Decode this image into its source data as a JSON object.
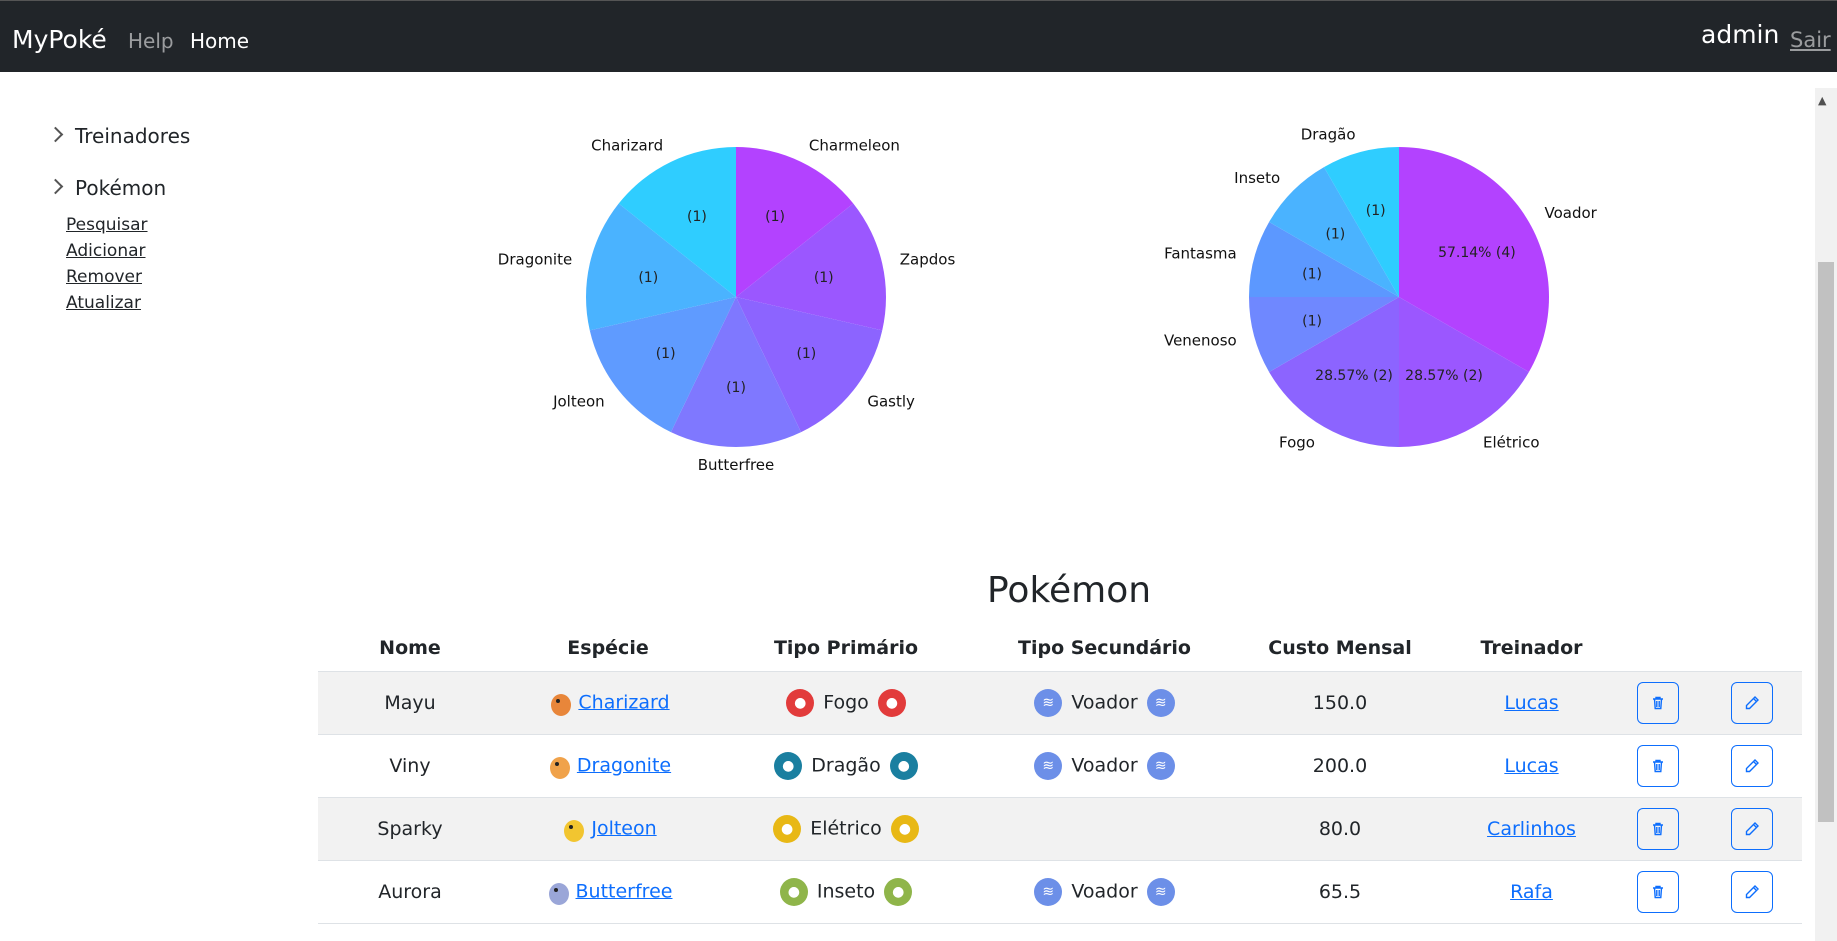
{
  "navbar": {
    "brand": "MyPoké",
    "links": [
      "Help",
      "Home"
    ],
    "user": "admin",
    "logout": "Sair"
  },
  "sidebar": {
    "groups": [
      {
        "label": "Treinadores",
        "expanded": false
      },
      {
        "label": "Pokémon",
        "expanded": true,
        "items": [
          "Pesquisar",
          "Adicionar",
          "Remover",
          "Atualizar"
        ]
      }
    ]
  },
  "chart_data": [
    {
      "type": "pie",
      "title": "",
      "categories": [
        "Charmeleon",
        "Zapdos",
        "Gastly",
        "Butterfree",
        "Jolteon",
        "Dragonite",
        "Charizard"
      ],
      "values": [
        1,
        1,
        1,
        1,
        1,
        1,
        1
      ],
      "labels": [
        "(1)",
        "(1)",
        "(1)",
        "(1)",
        "(1)",
        "(1)",
        "(1)"
      ],
      "colors": [
        "#b342ff",
        "#9b57ff",
        "#8c64ff",
        "#7f78ff",
        "#5f9bff",
        "#4ab3ff",
        "#2fcdff"
      ]
    },
    {
      "type": "pie",
      "title": "",
      "categories": [
        "Voador",
        "Elétrico",
        "Fogo",
        "Venenoso",
        "Fantasma",
        "Inseto",
        "Dragão"
      ],
      "values": [
        4,
        2,
        2,
        1,
        1,
        1,
        1
      ],
      "labels": [
        "57.14%  (4)",
        "28.57%  (2)",
        "28.57%  (2)",
        "(1)",
        "(1)",
        "(1)",
        "(1)"
      ],
      "colors": [
        "#b342ff",
        "#9b57ff",
        "#8c64ff",
        "#6f88ff",
        "#5c98ff",
        "#4ab3ff",
        "#2fcdff"
      ]
    }
  ],
  "table": {
    "title": "Pokémon",
    "headers": [
      "Nome",
      "Espécie",
      "Tipo Primário",
      "Tipo Secundário",
      "Custo Mensal",
      "Treinador",
      "",
      ""
    ],
    "rows": [
      {
        "nome": "Mayu",
        "especie": "Charizard",
        "tipo1": "Fogo",
        "tipo1_color": "#e23b3b",
        "tipo2": "Voador",
        "tipo2_color": "#6c8fe8",
        "custo": "150.0",
        "treinador": "Lucas"
      },
      {
        "nome": "Viny",
        "especie": "Dragonite",
        "tipo1": "Dragão",
        "tipo1_color": "#1a7fa0",
        "tipo2": "Voador",
        "tipo2_color": "#6c8fe8",
        "custo": "200.0",
        "treinador": "Lucas"
      },
      {
        "nome": "Sparky",
        "especie": "Jolteon",
        "tipo1": "Elétrico",
        "tipo1_color": "#e8b815",
        "tipo2": "",
        "tipo2_color": "",
        "custo": "80.0",
        "treinador": "Carlinhos"
      },
      {
        "nome": "Aurora",
        "especie": "Butterfree",
        "tipo1": "Inseto",
        "tipo1_color": "#8fb54a",
        "tipo2": "Voador",
        "tipo2_color": "#6c8fe8",
        "custo": "65.5",
        "treinador": "Rafa"
      }
    ]
  }
}
